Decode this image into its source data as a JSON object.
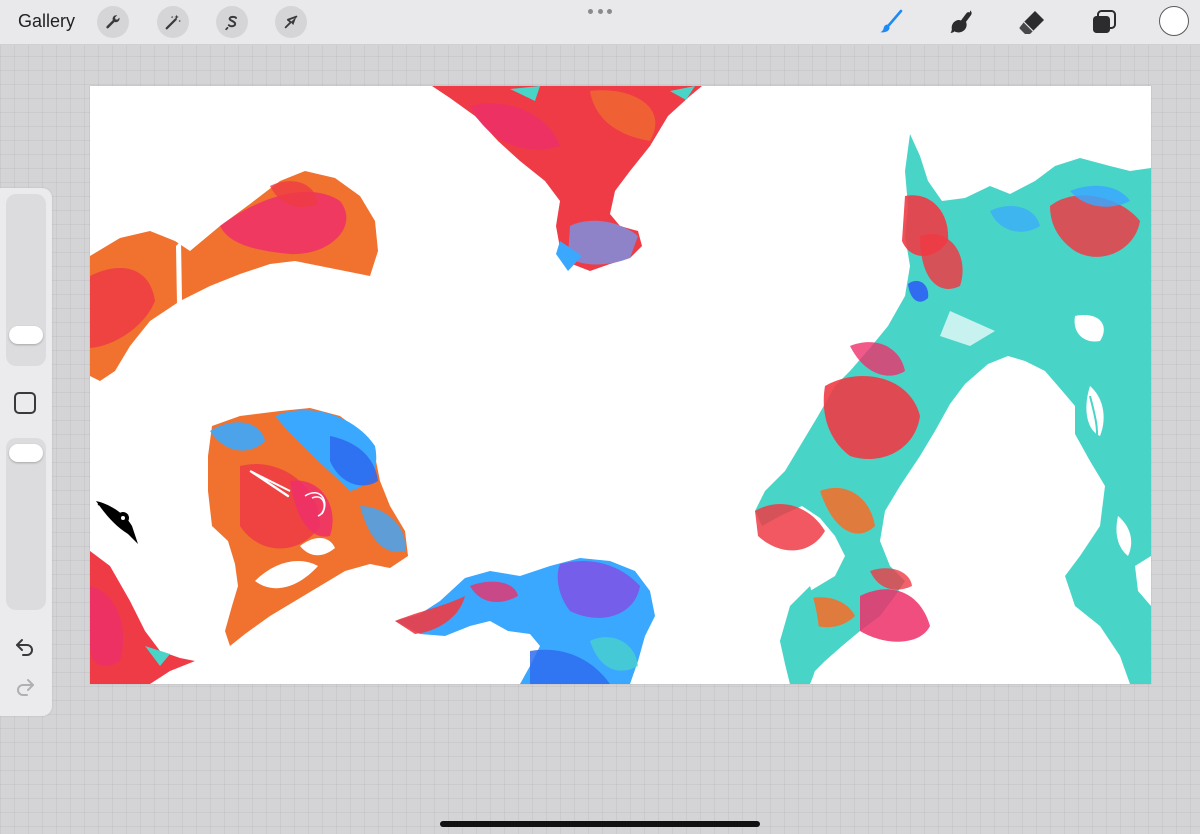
{
  "topbar": {
    "gallery_label": "Gallery",
    "left_tools": [
      {
        "name": "actions",
        "icon": "wrench-icon"
      },
      {
        "name": "adjustments",
        "icon": "magic-wand-icon"
      },
      {
        "name": "selection",
        "icon": "selection-s-icon"
      },
      {
        "name": "transform",
        "icon": "arrow-cursor-icon"
      }
    ],
    "more_menu_icon": "more-dots-icon",
    "right_tools": [
      {
        "name": "brush",
        "icon": "brush-icon",
        "active": true,
        "color": "#1e8af7"
      },
      {
        "name": "smudge",
        "icon": "smudge-finger-icon",
        "active": false
      },
      {
        "name": "eraser",
        "icon": "eraser-icon",
        "active": false
      },
      {
        "name": "layers",
        "icon": "layers-icon",
        "active": false
      }
    ],
    "current_color": "#ffffff"
  },
  "sidebar": {
    "brush_size_level": 0.3,
    "opacity_level": 1.0,
    "modifier_icon": "square-modifier-icon",
    "undo_icon": "undo-icon",
    "redo_icon": "redo-icon",
    "redo_enabled": false
  },
  "canvas": {
    "background": "#ffffff",
    "paint_colors": [
      "#ef3b45",
      "#f0722e",
      "#ee2f6a",
      "#49d4c8",
      "#3aa8ff",
      "#2f6cf0",
      "#7c55e8"
    ]
  }
}
